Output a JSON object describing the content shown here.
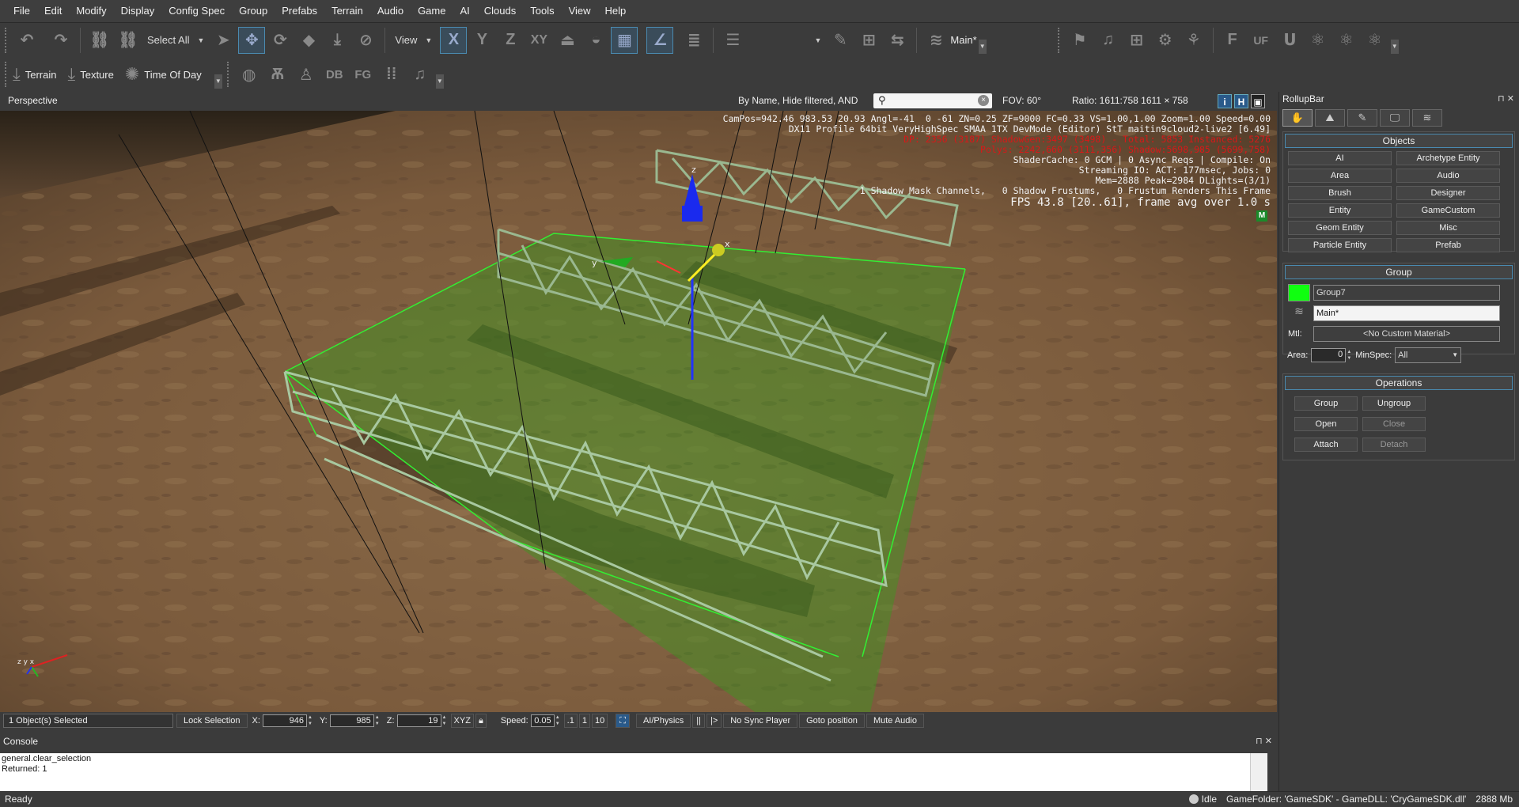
{
  "menu": [
    "File",
    "Edit",
    "Modify",
    "Display",
    "Config Spec",
    "Group",
    "Prefabs",
    "Terrain",
    "Audio",
    "Game",
    "AI",
    "Clouds",
    "Tools",
    "View",
    "Help"
  ],
  "toolbar1": {
    "select_all": "Select All",
    "view": "View",
    "axis_x": "X",
    "axis_y": "Y",
    "axis_z": "Z",
    "axis_xy": "XY",
    "layer": "Main*"
  },
  "toolbar2": {
    "terrain": "Terrain",
    "texture": "Texture",
    "time_of_day": "Time Of Day",
    "db": "DB",
    "fg": "FG",
    "right_f": "F",
    "right_uf": "UF"
  },
  "viewport": {
    "title": "Perspective",
    "filter": "By Name, Hide filtered, AND",
    "search_value": "",
    "fov": "FOV:   60°",
    "ratio": "Ratio:  1611:758    1611 × 758",
    "icons": [
      "i",
      "H",
      "▣"
    ],
    "hud_white_1": "CamPos=942.46 983.53 20.93 Angl=-41  0 -61 ZN=0.25 ZF=9000 FC=0.33 VS=1.00,1.00 Zoom=1.00 Speed=0.00",
    "hud_white_2": "DX11 Profile 64bit VeryHighSpec SMAA 1TX DevMode (Editor) StT maitin9cloud2-live2 [6.49]",
    "hud_red_1": "DP: 2356 (3187) ShadowGen:3497 (3498) - Total: 5853 Instanced: 5276",
    "hud_red_2": "Polys: 2242,660 (3111,356) Shadow:5698,985 (5699,758)",
    "hud_white_3": "ShaderCache: 0 GCM | 0 Async Reqs | Compile: On",
    "hud_white_4": "Streaming IO: ACT: 177msec, Jobs: 0",
    "hud_white_5": "Mem=2888 Peak=2984 DLights=(3/1)",
    "hud_white_6": "1 Shadow Mask Channels,   0 Shadow Frustums,   0 Frustum Renders This Frame",
    "hud_fps": "FPS 43.8 [20..61], frame avg over 1.0 s",
    "hud_m": "M",
    "gizmo_x": "x",
    "gizmo_y": "y",
    "gizmo_z": "z",
    "mini_axes": "z y x"
  },
  "status_strip": {
    "selected": "1 Object(s) Selected",
    "lock": "Lock Selection",
    "x_label": "X:",
    "x_value": "946",
    "y_label": "Y:",
    "y_value": "985",
    "z_label": "Z:",
    "z_value": "19",
    "xyz": "XYZ",
    "speed_label": "Speed:",
    "speed_value": "0.05",
    "speed_01": ".1",
    "speed_1": "1",
    "speed_10": "10",
    "ai_physics": "AI/Physics",
    "pause": "||",
    "step": "|>",
    "no_sync": "No Sync Player",
    "goto": "Goto position",
    "mute": "Mute Audio"
  },
  "console": {
    "title": "Console",
    "lines": [
      "general.clear_selection",
      "Returned: 1"
    ]
  },
  "statusbar": {
    "ready": "Ready",
    "idle": "Idle",
    "gamefolder": "GameFolder: 'GameSDK' - GameDLL: 'CryGameSDK.dll'",
    "memory": "2888 Mb"
  },
  "rollup": {
    "title": "RollupBar",
    "objects_header": "Objects",
    "object_buttons": [
      "AI",
      "Archetype Entity",
      "Area",
      "Audio",
      "Brush",
      "Designer",
      "Entity",
      "GameCustom",
      "Geom Entity",
      "Misc",
      "Particle Entity",
      "Prefab"
    ],
    "group_header": "Group",
    "group_name": "Group7",
    "group_color": "#10ff10",
    "layer": "Main*",
    "mtl_label": "Mtl:",
    "mtl_value": "<No Custom Material>",
    "area_label": "Area:",
    "area_value": "0",
    "minspec_label": "MinSpec:",
    "minspec_value": "All",
    "operations_header": "Operations",
    "op_group": "Group",
    "op_ungroup": "Ungroup",
    "op_open": "Open",
    "op_close": "Close",
    "op_attach": "Attach",
    "op_detach": "Detach"
  }
}
